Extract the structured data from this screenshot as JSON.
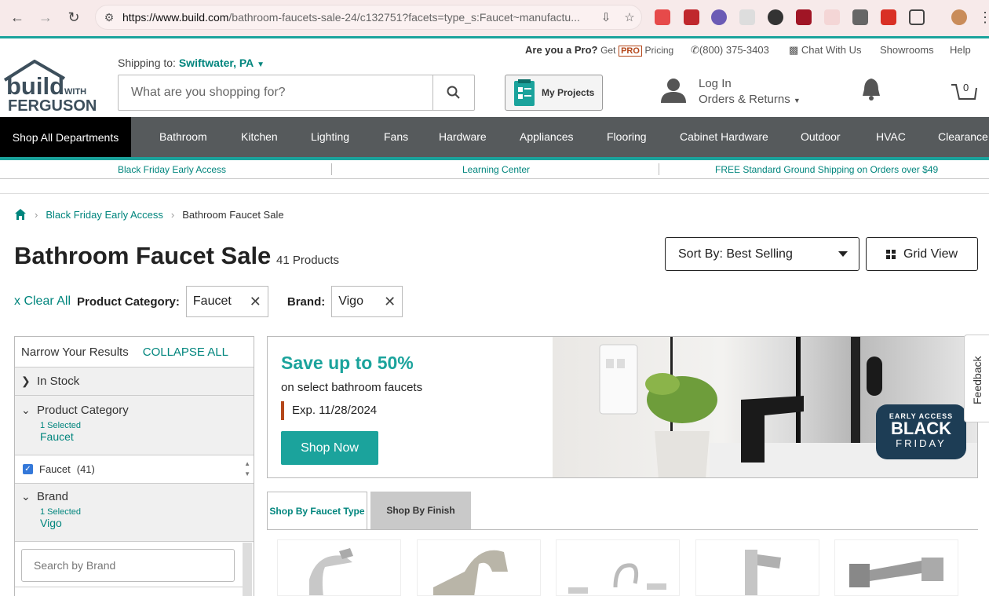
{
  "browser": {
    "url_host": "https://www.build.com",
    "url_path": "/bathroom-faucets-sale-24/c132751?facets=type_s:Faucet~manufactu..."
  },
  "utility": {
    "pro_q": "Are you a Pro?",
    "get": "Get",
    "pro_badge": "PRO",
    "pricing": "Pricing",
    "phone": "(800) 375-3403",
    "chat": "Chat With Us",
    "showrooms": "Showrooms",
    "help": "Help"
  },
  "logo": {
    "build": "build",
    "with": "WITH",
    "ferguson": "FERGUSON"
  },
  "shipping": {
    "label": "Shipping to:",
    "location": "Swiftwater, PA"
  },
  "search": {
    "placeholder": "What are you shopping for?"
  },
  "my_projects": "My Projects",
  "account": {
    "login": "Log In",
    "orders": "Orders & Returns"
  },
  "cart": {
    "count": "0"
  },
  "nav": {
    "all": "Shop All Departments",
    "items": [
      "Bathroom",
      "Kitchen",
      "Lighting",
      "Fans",
      "Hardware",
      "Appliances",
      "Flooring",
      "Cabinet Hardware",
      "Outdoor",
      "HVAC",
      "Clearance"
    ]
  },
  "promo": {
    "left": "Black Friday Early Access",
    "mid": "Learning Center",
    "right": "FREE Standard Ground Shipping on Orders over $49"
  },
  "breadcrumb": {
    "parent": "Black Friday Early Access",
    "current": "Bathroom Faucet Sale"
  },
  "page": {
    "title": "Bathroom Faucet Sale",
    "count": "41 Products"
  },
  "sort": {
    "label": "Sort By: Best Selling"
  },
  "view": {
    "label": "Grid View"
  },
  "filters": {
    "clear": "x Clear All",
    "category_label": "Product Category:",
    "category_value": "Faucet",
    "brand_label": "Brand:",
    "brand_value": "Vigo"
  },
  "sidebar": {
    "narrow": "Narrow Your Results",
    "collapse": "COLLAPSE ALL",
    "in_stock": "In Stock",
    "category": "Product Category",
    "category_selected": "1 Selected",
    "category_value": "Faucet",
    "facet_label": "Faucet",
    "facet_count": "(41)",
    "brand": "Brand",
    "brand_selected": "1 Selected",
    "brand_value": "Vigo",
    "brand_search_placeholder": "Search by Brand"
  },
  "banner": {
    "title": "Save up to 50%",
    "subtitle": "on select bathroom faucets",
    "expiry": "Exp. 11/28/2024",
    "cta": "Shop Now",
    "badge_top": "EARLY ACCESS",
    "badge_mid": "BLACK",
    "badge_bot": "FRIDAY"
  },
  "feedback": "Feedback",
  "tabs": {
    "faucet_type": "Shop By Faucet Type",
    "finish": "Shop By Finish"
  },
  "colors": {
    "accent": "#1ba39c",
    "link": "#00857d",
    "nav_bg": "#565a5c"
  }
}
